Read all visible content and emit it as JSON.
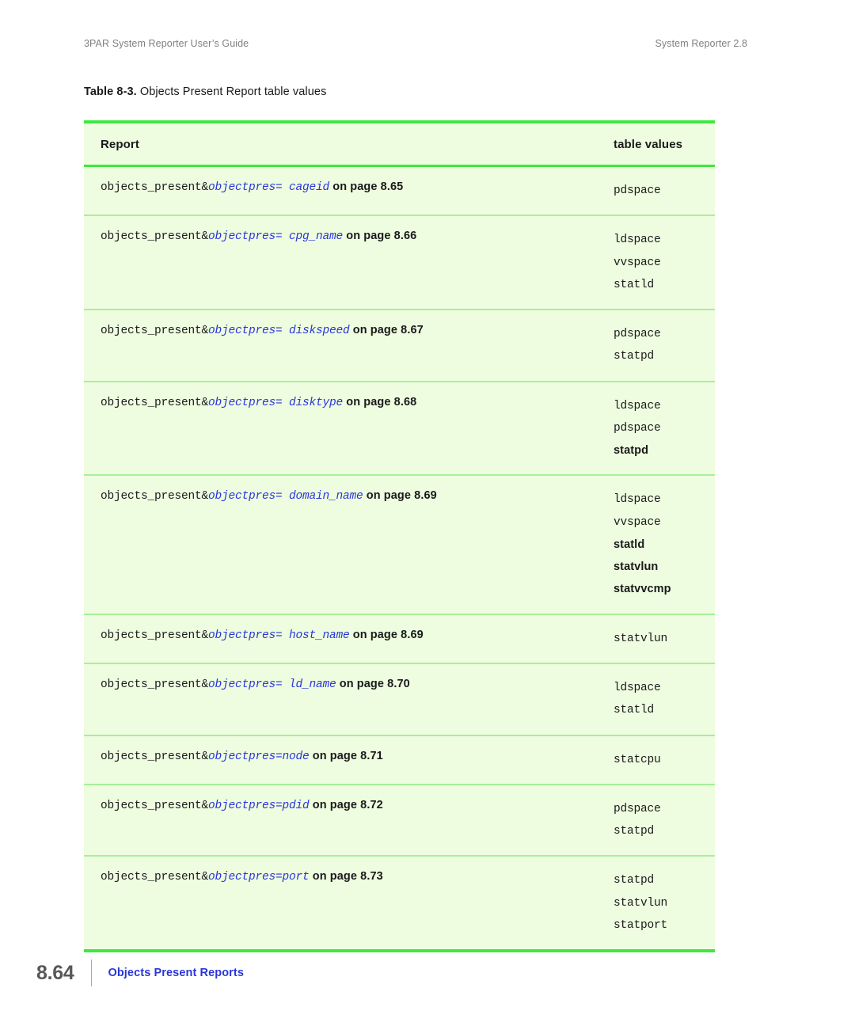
{
  "header": {
    "left": "3PAR System Reporter User’s Guide",
    "right": "System Reporter 2.8"
  },
  "caption": {
    "label": "Table 8-3.",
    "text": "Objects Present Report table values"
  },
  "table": {
    "columns": {
      "report": "Report",
      "values": "table values"
    },
    "rows": [
      {
        "prefix": "objects_present&",
        "link": "objectpres= cageid",
        "suffix": "on page 8.65",
        "values": [
          {
            "text": "pdspace",
            "style": "mono"
          }
        ]
      },
      {
        "prefix": "objects_present&",
        "link": "objectpres= cpg_name",
        "suffix": "on page 8.66",
        "values": [
          {
            "text": "ldspace",
            "style": "mono"
          },
          {
            "text": "vvspace",
            "style": "mono"
          },
          {
            "text": "statld",
            "style": "mono"
          }
        ]
      },
      {
        "prefix": "objects_present&",
        "link": "objectpres= diskspeed",
        "suffix": "on page 8.67",
        "values": [
          {
            "text": "pdspace",
            "style": "mono"
          },
          {
            "text": "statpd",
            "style": "mono"
          }
        ]
      },
      {
        "prefix": "objects_present&",
        "link": "objectpres= disktype",
        "suffix": "on page 8.68",
        "values": [
          {
            "text": "ldspace",
            "style": "mono"
          },
          {
            "text": "pdspace",
            "style": "mono"
          },
          {
            "text": "statpd",
            "style": "bold-sans"
          }
        ]
      },
      {
        "prefix": "objects_present&",
        "link": "objectpres= domain_name",
        "suffix": "on page 8.69",
        "values": [
          {
            "text": "ldspace",
            "style": "mono"
          },
          {
            "text": "vvspace",
            "style": "mono"
          },
          {
            "text": "statld",
            "style": "bold-sans"
          },
          {
            "text": "statvlun",
            "style": "bold-sans"
          },
          {
            "text": "statvvcmp",
            "style": "bold-sans"
          }
        ]
      },
      {
        "prefix": "objects_present&",
        "link": "objectpres= host_name",
        "suffix": "on page 8.69",
        "values": [
          {
            "text": "statvlun",
            "style": "mono"
          }
        ]
      },
      {
        "prefix": "objects_present&",
        "link": "objectpres= ld_name",
        "suffix": "on page 8.70",
        "values": [
          {
            "text": "ldspace",
            "style": "mono"
          },
          {
            "text": "statld",
            "style": "mono"
          }
        ]
      },
      {
        "prefix": "objects_present&",
        "link": "objectpres=node",
        "suffix": "on page 8.71",
        "values": [
          {
            "text": "statcpu",
            "style": "mono"
          }
        ]
      },
      {
        "prefix": "objects_present&",
        "link": "objectpres=pdid",
        "suffix": "on page 8.72",
        "values": [
          {
            "text": "pdspace",
            "style": "mono"
          },
          {
            "text": "statpd",
            "style": "mono"
          }
        ]
      },
      {
        "prefix": "objects_present&",
        "link": "objectpres=port",
        "suffix": "on page 8.73",
        "values": [
          {
            "text": "statpd",
            "style": "mono"
          },
          {
            "text": "statvlun",
            "style": "mono"
          },
          {
            "text": "statport",
            "style": "mono"
          }
        ]
      }
    ]
  },
  "footer": {
    "page_number": "8.64",
    "section_title": "Objects Present Reports"
  },
  "colors": {
    "table_background": "#eefce0",
    "border_strong": "#3fe83f",
    "border_light": "#a8f09a",
    "link_blue": "#2a36d8",
    "header_gray": "#808080",
    "folio_gray": "#58585a"
  }
}
